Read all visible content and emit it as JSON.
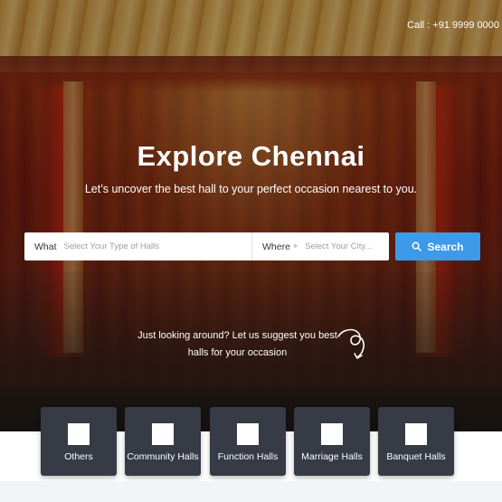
{
  "header": {
    "call": "Call : +91 9999 0000"
  },
  "hero": {
    "title": "Explore Chennai",
    "subtitle": "Let’s uncover the best hall to your perfect occasion nearest to you."
  },
  "search": {
    "what_label": "What",
    "what_placeholder": "Select Your Type of Halls",
    "where_label": "Where",
    "where_icon": "crosshair-icon",
    "where_placeholder": "Select Your City...",
    "button_label": "Search",
    "button_icon": "search-icon",
    "accent": "#3d9ae8"
  },
  "suggest": {
    "line1": "Just looking around? Let us suggest you best",
    "line2": "halls for your occasion"
  },
  "categories": [
    {
      "label": "Others"
    },
    {
      "label": "Community Halls"
    },
    {
      "label": "Function Halls"
    },
    {
      "label": "Marriage Halls"
    },
    {
      "label": "Banquet Halls"
    }
  ]
}
